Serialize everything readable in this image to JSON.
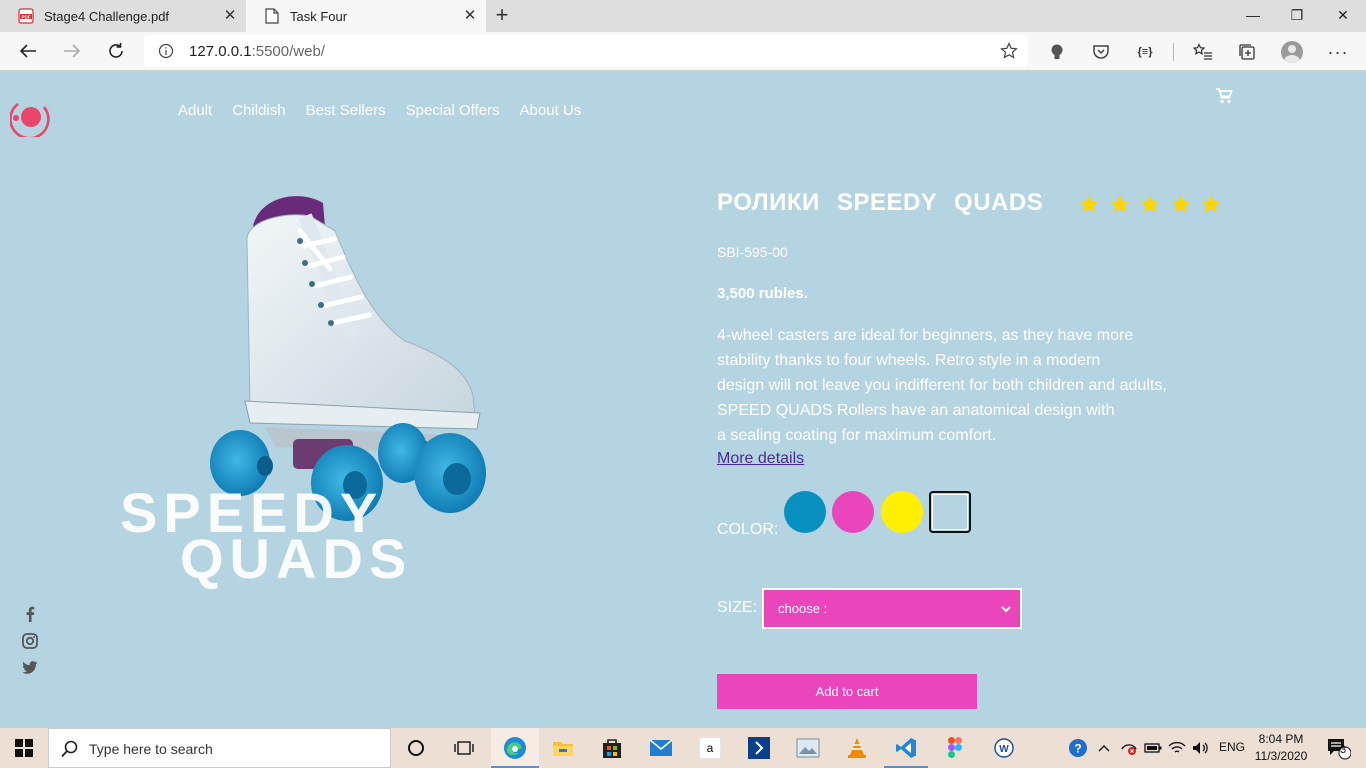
{
  "browser": {
    "tabs": [
      {
        "title": "Stage4 Challenge.pdf",
        "icon": "pdf-icon"
      },
      {
        "title": "Task Four",
        "icon": "page-icon"
      }
    ],
    "url_host": "127.0.0.1",
    "url_rest": ":5500/web/"
  },
  "site": {
    "nav": [
      "Adult",
      "Childish",
      "Best Sellers",
      "Special Offers",
      "About Us"
    ],
    "hero_line1": "SPEEDY",
    "hero_line2": "QUADS",
    "colors": {
      "brand": "#ea45bb",
      "background": "#b5d4e1",
      "star": "#ffd400"
    }
  },
  "product": {
    "title": "РОЛИКИ SPEEDY QUADS",
    "rating": 5,
    "sku": "SBI-595-00",
    "price": "3,500 rubles.",
    "description": [
      "4-wheel casters are ideal for beginners, as they have more",
      "stability thanks to four wheels. Retro style in a modern",
      "design will not leave you indifferent for both children and adults,",
      "SPEED QUADS Rollers have an anatomical design with",
      "a sealing coating for maximum comfort."
    ],
    "more_link": "More details",
    "color_label": "COLOR:",
    "swatches": [
      "#0890c0",
      "#ea45bb",
      "#ffef00",
      "#b5d4e1"
    ],
    "size_label": "SIZE:",
    "size_placeholder": "choose :",
    "add_to_cart": "Add to cart"
  },
  "taskbar": {
    "search_placeholder": "Type here to search",
    "language": "ENG",
    "time": "8:04 PM",
    "date": "11/3/2020",
    "notifications": "3"
  }
}
